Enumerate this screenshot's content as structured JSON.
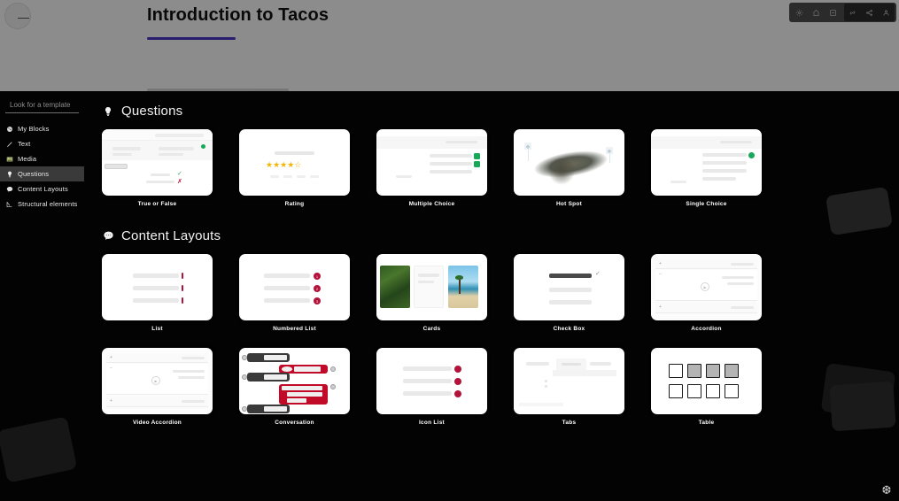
{
  "editor": {
    "menu_button": "menu-icon",
    "doc_title": "Introduction to Tacos",
    "accent_color": "#4b35c7",
    "toolbar_icons": [
      "settings-icon",
      "preview-icon",
      "translate-icon",
      "link-icon",
      "share-icon",
      "user-icon"
    ]
  },
  "panel": {
    "search": {
      "placeholder": "Look for a template",
      "value": ""
    },
    "sidebar": {
      "items": [
        {
          "label": "My Blocks",
          "icon": "blocks-icon",
          "active": false
        },
        {
          "label": "Text",
          "icon": "pencil-icon",
          "active": false
        },
        {
          "label": "Media",
          "icon": "image-icon",
          "active": false
        },
        {
          "label": "Questions",
          "icon": "lightbulb-icon",
          "active": true
        },
        {
          "label": "Content Layouts",
          "icon": "speech-bubble-icon",
          "active": false
        },
        {
          "label": "Structural elements",
          "icon": "structure-icon",
          "active": false
        }
      ]
    },
    "sections": [
      {
        "title": "Questions",
        "icon": "lightbulb-icon",
        "templates": [
          {
            "label": "True or False",
            "thumb": "true-or-false"
          },
          {
            "label": "Rating",
            "thumb": "rating"
          },
          {
            "label": "Multiple Choice",
            "thumb": "multiple-choice"
          },
          {
            "label": "Hot Spot",
            "thumb": "hot-spot"
          },
          {
            "label": "Single Choice",
            "thumb": "single-choice"
          }
        ]
      },
      {
        "title": "Content Layouts",
        "icon": "speech-bubble-icon",
        "templates": [
          {
            "label": "List",
            "thumb": "list"
          },
          {
            "label": "Numbered List",
            "thumb": "numbered-list"
          },
          {
            "label": "Cards",
            "thumb": "cards"
          },
          {
            "label": "Check Box",
            "thumb": "check-box"
          },
          {
            "label": "Accordion",
            "thumb": "accordion"
          },
          {
            "label": "Video Accordion",
            "thumb": "video-accordion"
          },
          {
            "label": "Conversation",
            "thumb": "conversation"
          },
          {
            "label": "Icon List",
            "thumb": "icon-list"
          },
          {
            "label": "Tabs",
            "thumb": "tabs"
          },
          {
            "label": "Table",
            "thumb": "table"
          }
        ]
      }
    ],
    "numbered_list_numbers": [
      "1",
      "2",
      "3"
    ],
    "rating_stars": "★★★★☆",
    "helper_icon": "snowflake-icon"
  }
}
